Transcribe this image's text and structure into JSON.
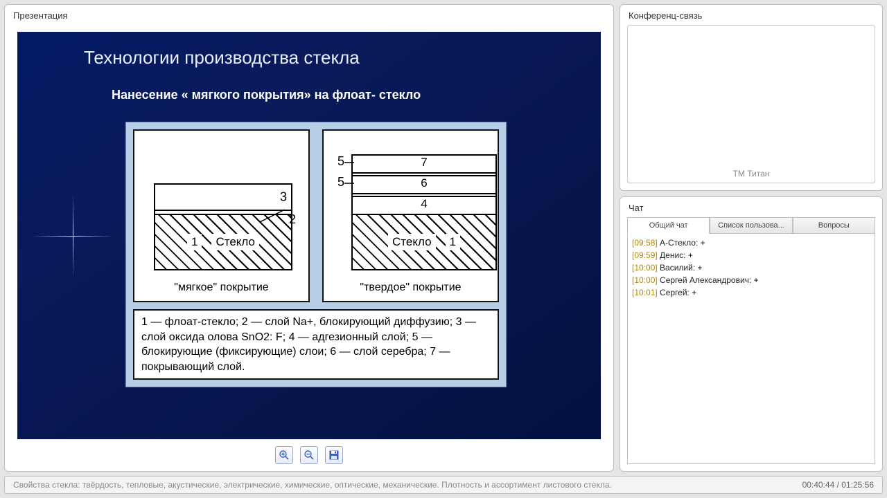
{
  "panels": {
    "presentation_title": "Презентация",
    "conference_title": "Конференц-связь",
    "chat_title": "Чат"
  },
  "slide": {
    "title": "Технологии производства стекла",
    "subtitle": "Нанесение « мягкого покрытия» на флоат- стекло",
    "soft": {
      "caption": "\"мягкое\" покрытие",
      "layer3": "3",
      "lead2": "2",
      "layer1_num": "1",
      "layer1_text": "Стекло"
    },
    "hard": {
      "caption": "\"твердое\" покрытие",
      "l7": "7",
      "l6": "6",
      "l4": "4",
      "l5a": "5",
      "l5b": "5",
      "layer1_num": "1",
      "layer1_text": "Стекло"
    },
    "legend": "1 — флоат-стекло; 2 — слой Na+, блокирующий диффузию; 3 — слой оксида олова SnO2: F; 4 — адгезионный слой; 5 — блокирующие (фиксирующие) слои; 6 — слой серебра; 7 — покрывающий слой."
  },
  "toolbar": {
    "zoom_in": "zoom-in",
    "zoom_out": "zoom-out",
    "save": "save"
  },
  "conference": {
    "watermark": "ТМ Титан"
  },
  "chat": {
    "tabs": [
      "Общий чат",
      "Список пользова...",
      "Вопросы"
    ],
    "messages": [
      {
        "time": "[09:58]",
        "user": "А-Стекло:",
        "text": " +"
      },
      {
        "time": "[09:59]",
        "user": "Денис:",
        "text": " +"
      },
      {
        "time": "[10:00]",
        "user": "Василий:",
        "text": " +"
      },
      {
        "time": "[10:00]",
        "user": "Сергей Александрович:",
        "text": " +"
      },
      {
        "time": "[10:01]",
        "user": "Сергей:",
        "text": " +"
      }
    ]
  },
  "footer": {
    "text": "Свойства стекла: твёрдость, тепловые, акустические, электрические, химические, оптические, механические. Плотность и ассортимент листового стекла.",
    "time": "00:40:44 / 01:25:56"
  }
}
